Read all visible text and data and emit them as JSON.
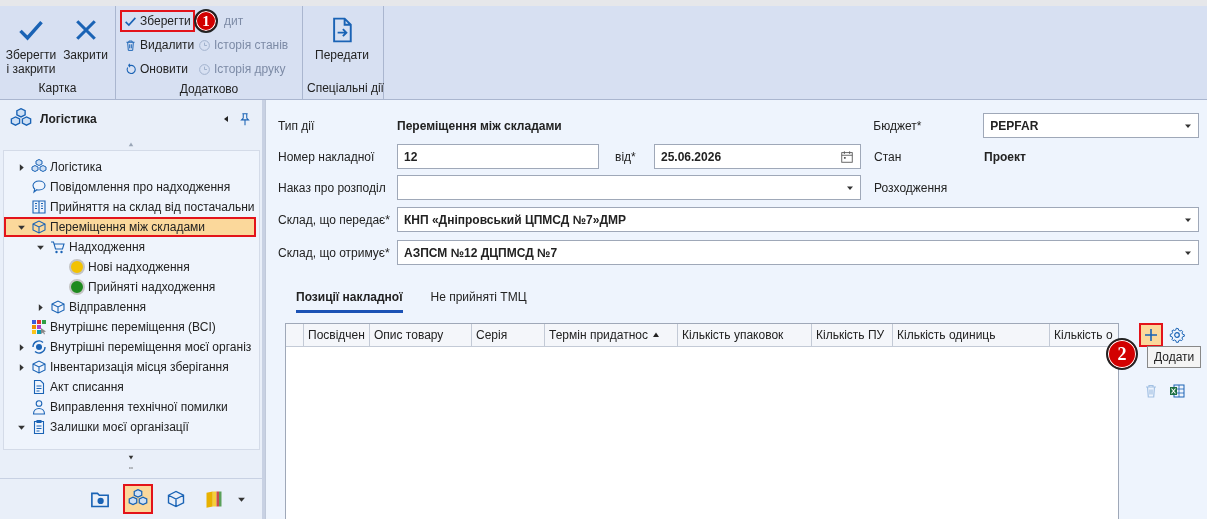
{
  "ribbon": {
    "groups": [
      {
        "title": "Картка",
        "large_buttons": [
          {
            "label": "Зберегти і закрити"
          },
          {
            "label": "Закрити"
          }
        ]
      },
      {
        "title": "Додатково",
        "small_buttons": [
          {
            "label": "Зберегти",
            "disabled": false,
            "highlighted": true
          },
          {
            "label": "дит",
            "disabled": true,
            "highlighted": false
          },
          {
            "label": "Видалити",
            "disabled": false,
            "highlighted": false
          },
          {
            "label": "Історія станів",
            "disabled": true,
            "highlighted": false
          },
          {
            "label": "Оновити",
            "disabled": false,
            "highlighted": false
          },
          {
            "label": "Історія друку",
            "disabled": true,
            "highlighted": false
          }
        ]
      },
      {
        "title": "Спеціальні дії",
        "large_buttons": [
          {
            "label": "Передати"
          }
        ]
      }
    ]
  },
  "sidebar": {
    "title": "Логістика",
    "tree": [
      {
        "label": "Логістика",
        "expanded": false,
        "selected": false
      },
      {
        "label": "Повідомлення про надходження",
        "selected": false
      },
      {
        "label": "Прийняття на склад від постачальни",
        "selected": false
      },
      {
        "label": "Переміщення між складами",
        "expanded": true,
        "selected": true,
        "children": [
          {
            "label": "Надходження",
            "expanded": true,
            "selected": false,
            "children": [
              {
                "label": "Нові надходження",
                "selected": false,
                "color": "#f2c200"
              },
              {
                "label": "Прийняті надходження",
                "selected": false,
                "color": "#1e8a1e"
              }
            ]
          },
          {
            "label": "Відправлення",
            "expanded": false,
            "selected": false
          }
        ]
      },
      {
        "label": "Внутрішнє переміщення (ВСІ)",
        "selected": false
      },
      {
        "label": "Внутрішні переміщення моєї організ",
        "expanded": false,
        "selected": false
      },
      {
        "label": "Інвентаризація місця зберігання",
        "expanded": false,
        "selected": false
      },
      {
        "label": "Акт списання",
        "selected": false
      },
      {
        "label": "Виправлення технічної помилки",
        "selected": false
      },
      {
        "label": "Залишки моєї організації",
        "expanded": true,
        "selected": false
      }
    ],
    "bottom_icons": [
      {
        "selected": false
      },
      {
        "selected": true
      },
      {
        "selected": false
      },
      {
        "selected": false
      }
    ]
  },
  "form": {
    "action_type": {
      "label": "Тип дії",
      "value": "Переміщення між складами"
    },
    "budget": {
      "label": "Бюджет*",
      "value": "PEPFAR"
    },
    "invoice_number": {
      "label": "Номер накладної",
      "value": "12"
    },
    "date": {
      "label": "від*",
      "value": "25.06.2026"
    },
    "status": {
      "label": "Стан",
      "value": "Проект"
    },
    "order": {
      "label": "Наказ про розподіл"
    },
    "discrepancy": {
      "label": "Розходження"
    },
    "sender": {
      "label": "Склад, що передає*",
      "value": "КНП «Дніпровський ЦПМСД №7»ДМР"
    },
    "receiver": {
      "label": "Склад, що отримує*",
      "value": "АЗПСМ №12 ДЦПМСД №7"
    }
  },
  "tabs": [
    {
      "label": "Позиції накладної",
      "selected": true
    },
    {
      "label": "Не прийняті ТМЦ",
      "selected": false
    }
  ],
  "table": {
    "columns": [
      {
        "label": "Посвідчен",
        "sorted": false
      },
      {
        "label": "Опис товару",
        "sorted": false
      },
      {
        "label": "Серія",
        "sorted": false
      },
      {
        "label": "Термін придатнос",
        "sorted": true
      },
      {
        "label": "Кількість упаковок",
        "sorted": false
      },
      {
        "label": "Кількість ПУ",
        "sorted": false
      },
      {
        "label": "Кількість одиниць",
        "sorted": false
      },
      {
        "label": "Кількість о",
        "sorted": false
      }
    ]
  },
  "table_tools": {
    "add_highlighted": true,
    "tooltip": "Додати"
  },
  "callouts": [
    "1",
    "2"
  ]
}
